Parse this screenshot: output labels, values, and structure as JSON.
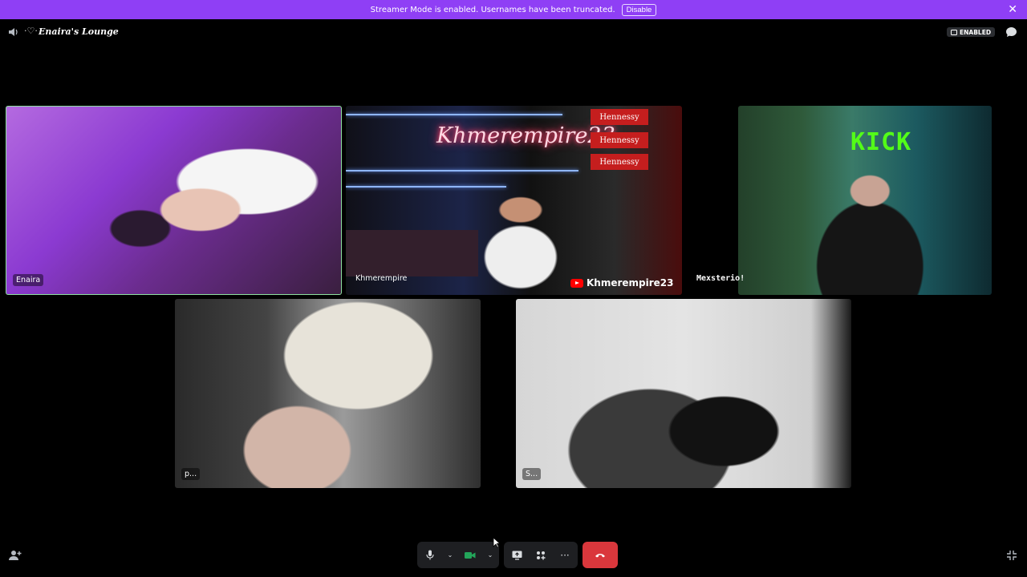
{
  "banner": {
    "message": "Streamer Mode is enabled. Usernames have been truncated.",
    "disable_label": "Disable",
    "close_symbol": "✕",
    "color": "#8f3ff5"
  },
  "header": {
    "channel_glyph": "·♡·",
    "title": "Enaira's Lounge",
    "badge_label": "ENABLED"
  },
  "tiles": [
    {
      "label": "Enaira"
    },
    {
      "label": "Khmerempire",
      "neon": "Khmerempire23",
      "hennessy": [
        "Hennessy",
        "Hennessy",
        "Hennessy"
      ],
      "overlay": "Khmerempire23"
    },
    {
      "sign": "KICK",
      "name_overlay": "Mexsterio!"
    },
    {
      "label": "p..."
    },
    {
      "label": "S..."
    }
  ],
  "controls": {
    "more_symbol": "···",
    "end_call_color": "#da373c",
    "camera_color": "#23a55a"
  }
}
